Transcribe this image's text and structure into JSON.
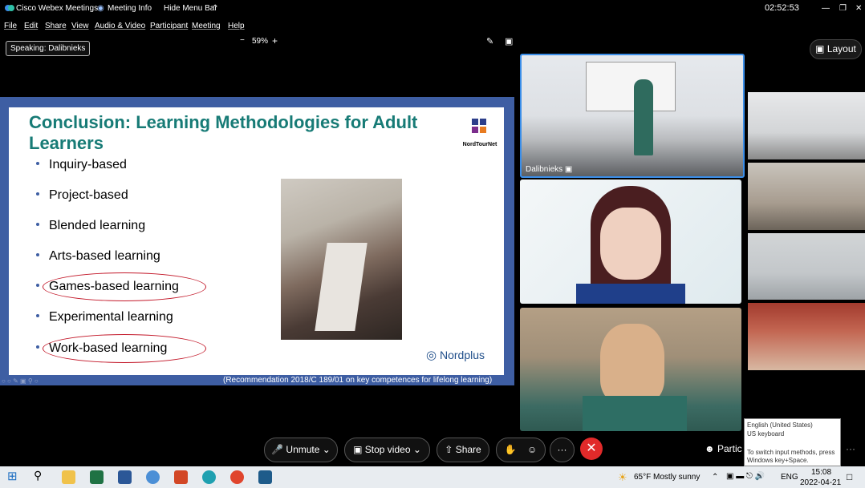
{
  "window": {
    "app_title": "Cisco Webex Meetings",
    "meeting_info": "Meeting Info",
    "hide_menu": "Hide Menu Bar",
    "timer": "02:52:53"
  },
  "menu": [
    "File",
    "Edit",
    "Share",
    "View",
    "Audio & Video",
    "Participant",
    "Meeting",
    "Help"
  ],
  "toolbar": {
    "zoom_minus": "−",
    "zoom": "59%",
    "zoom_plus": "+"
  },
  "speaking": {
    "label": "Speaking:",
    "name": "Dalibnieks"
  },
  "layout_button": "Layout",
  "slide": {
    "title": "Conclusion: Learning Methodologies for Adult Learners",
    "bullets": [
      "Inquiry-based",
      "Project-based",
      "Blended learning",
      "Arts-based learning",
      "Games-based learning",
      "Experimental learning",
      "Work-based learning"
    ],
    "circled": [
      4,
      6
    ],
    "logo_text": "NordTourNet",
    "footer_logo": "Nordplus",
    "caption": "(Recommendation 2018/C 189/01 on key competences for lifelong learning)"
  },
  "video": {
    "active_speaker": "Dalibnieks"
  },
  "controls": {
    "unmute": "Unmute",
    "stop_video": "Stop video",
    "share": "Share",
    "more": "···",
    "participants": "Partic"
  },
  "input_tooltip": {
    "line1": "English (United States)",
    "line2": "US keyboard",
    "line3": "To switch input methods, press Windows key+Space."
  },
  "taskbar": {
    "weather": "65°F  Mostly sunny",
    "lang": "ENG",
    "time": "15:08",
    "date": "2022-04-21"
  },
  "colors": {
    "accent_blue": "#3b8ee8",
    "end_red": "#e12a2a",
    "slide_title": "#177b76",
    "slide_border": "#3e5ea3",
    "ellipse": "#c3192a"
  }
}
